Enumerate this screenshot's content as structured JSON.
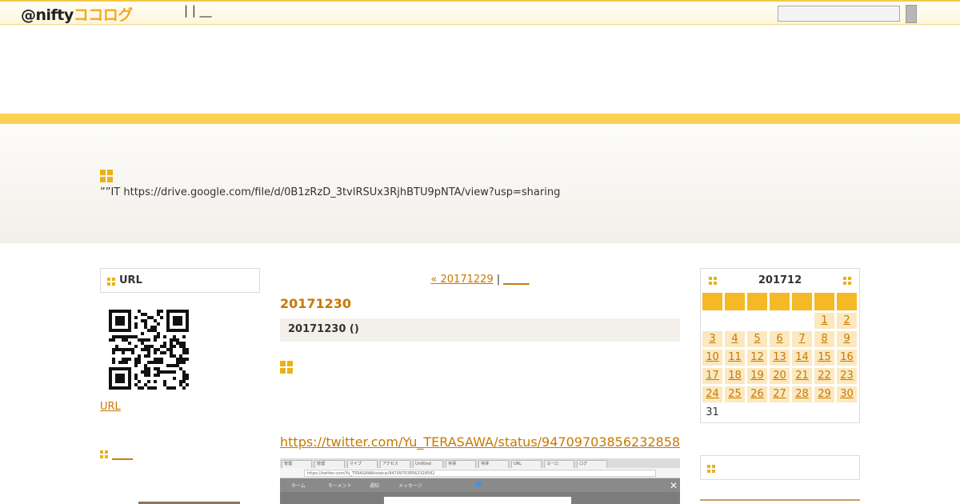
{
  "header": {
    "brand_prefix": "@nifty",
    "brand_suffix": "ココログ",
    "nav_text": "|  |  __",
    "search_placeholder": ""
  },
  "hero": {
    "text": "””IT  https://drive.google.com/file/d/0B1zRzD_3tvlRSUx3RjhBTU9pNTA/view?usp=sharing"
  },
  "left": {
    "box_title": "URL",
    "url_link": "URL",
    "section2_link": "____"
  },
  "main": {
    "prev_link": "« 20171229",
    "separator": "|",
    "next_link": "_____",
    "date_heading": "20171230",
    "post_title": "20171230 ()",
    "post_link": "https://twitter.com/Yu_TERASAWA/status/94709703856232858",
    "shot_url": "https://twitter.com/Yu_TERASAWA/status/947097038562328582",
    "shot_nav": [
      "ホーム",
      "モーメント",
      "通知",
      "メッセージ"
    ],
    "shot_tabs": [
      "管理",
      "管理",
      "マイブ",
      "アクセス",
      "Untitled",
      "寺澤",
      "寺澤",
      "URL",
      "ヨーロ",
      "ログ"
    ]
  },
  "calendar": {
    "month": "201712",
    "rows": [
      [
        "",
        "",
        "",
        "",
        "",
        "1",
        "2"
      ],
      [
        "3",
        "4",
        "5",
        "6",
        "7",
        "8",
        "9"
      ],
      [
        "10",
        "11",
        "12",
        "13",
        "14",
        "15",
        "16"
      ],
      [
        "17",
        "18",
        "19",
        "20",
        "21",
        "22",
        "23"
      ],
      [
        "24",
        "25",
        "26",
        "27",
        "28",
        "29",
        "30"
      ],
      [
        "31",
        "",
        "",
        "",
        "",
        "",
        ""
      ]
    ],
    "unlinked": [
      "31"
    ]
  },
  "colors": {
    "accent": "#f5b925",
    "link": "#c87800",
    "stripe": "#fcd154"
  }
}
